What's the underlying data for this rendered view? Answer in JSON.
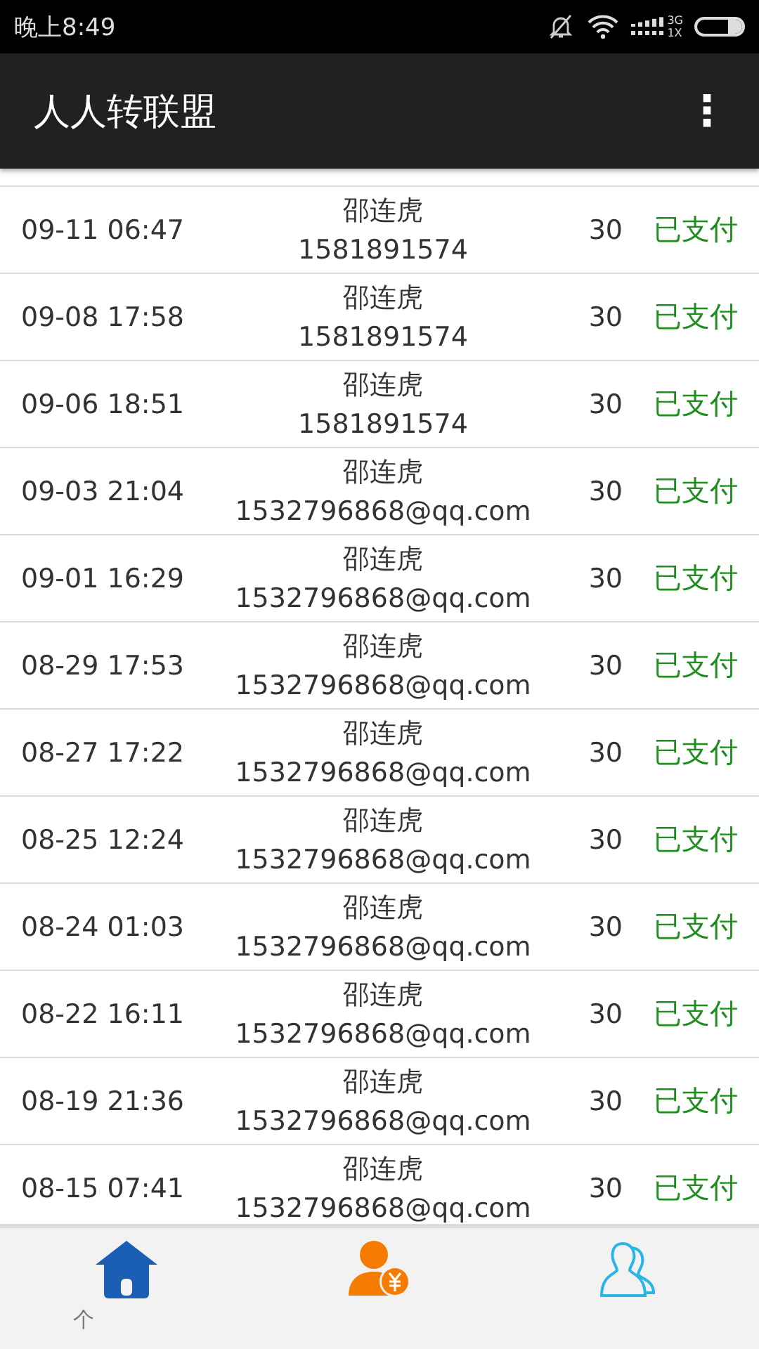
{
  "status_bar": {
    "time": "晚上8:49",
    "network_top": "3G",
    "network_bottom": "1X"
  },
  "app_bar": {
    "title": "人人转联盟",
    "menu": "⋮"
  },
  "rows": [
    {
      "time": "09-11 06:47",
      "name": "邵连虎",
      "account": "1581891574",
      "amount": "30",
      "status": "已支付"
    },
    {
      "time": "09-08 17:58",
      "name": "邵连虎",
      "account": "1581891574",
      "amount": "30",
      "status": "已支付"
    },
    {
      "time": "09-06 18:51",
      "name": "邵连虎",
      "account": "1581891574",
      "amount": "30",
      "status": "已支付"
    },
    {
      "time": "09-03 21:04",
      "name": "邵连虎",
      "account": "1532796868@qq.com",
      "amount": "30",
      "status": "已支付"
    },
    {
      "time": "09-01 16:29",
      "name": "邵连虎",
      "account": "1532796868@qq.com",
      "amount": "30",
      "status": "已支付"
    },
    {
      "time": "08-29 17:53",
      "name": "邵连虎",
      "account": "1532796868@qq.com",
      "amount": "30",
      "status": "已支付"
    },
    {
      "time": "08-27 17:22",
      "name": "邵连虎",
      "account": "1532796868@qq.com",
      "amount": "30",
      "status": "已支付"
    },
    {
      "time": "08-25 12:24",
      "name": "邵连虎",
      "account": "1532796868@qq.com",
      "amount": "30",
      "status": "已支付"
    },
    {
      "time": "08-24 01:03",
      "name": "邵连虎",
      "account": "1532796868@qq.com",
      "amount": "30",
      "status": "已支付"
    },
    {
      "time": "08-22 16:11",
      "name": "邵连虎",
      "account": "1532796868@qq.com",
      "amount": "30",
      "status": "已支付"
    },
    {
      "time": "08-19 21:36",
      "name": "邵连虎",
      "account": "1532796868@qq.com",
      "amount": "30",
      "status": "已支付"
    },
    {
      "time": "08-15 07:41",
      "name": "邵连虎",
      "account": "1532796868@qq.com",
      "amount": "30",
      "status": "已支付"
    }
  ],
  "bottom_nav": [
    {
      "kind": "home",
      "label": "个"
    },
    {
      "kind": "payee"
    },
    {
      "kind": "contacts"
    }
  ]
}
